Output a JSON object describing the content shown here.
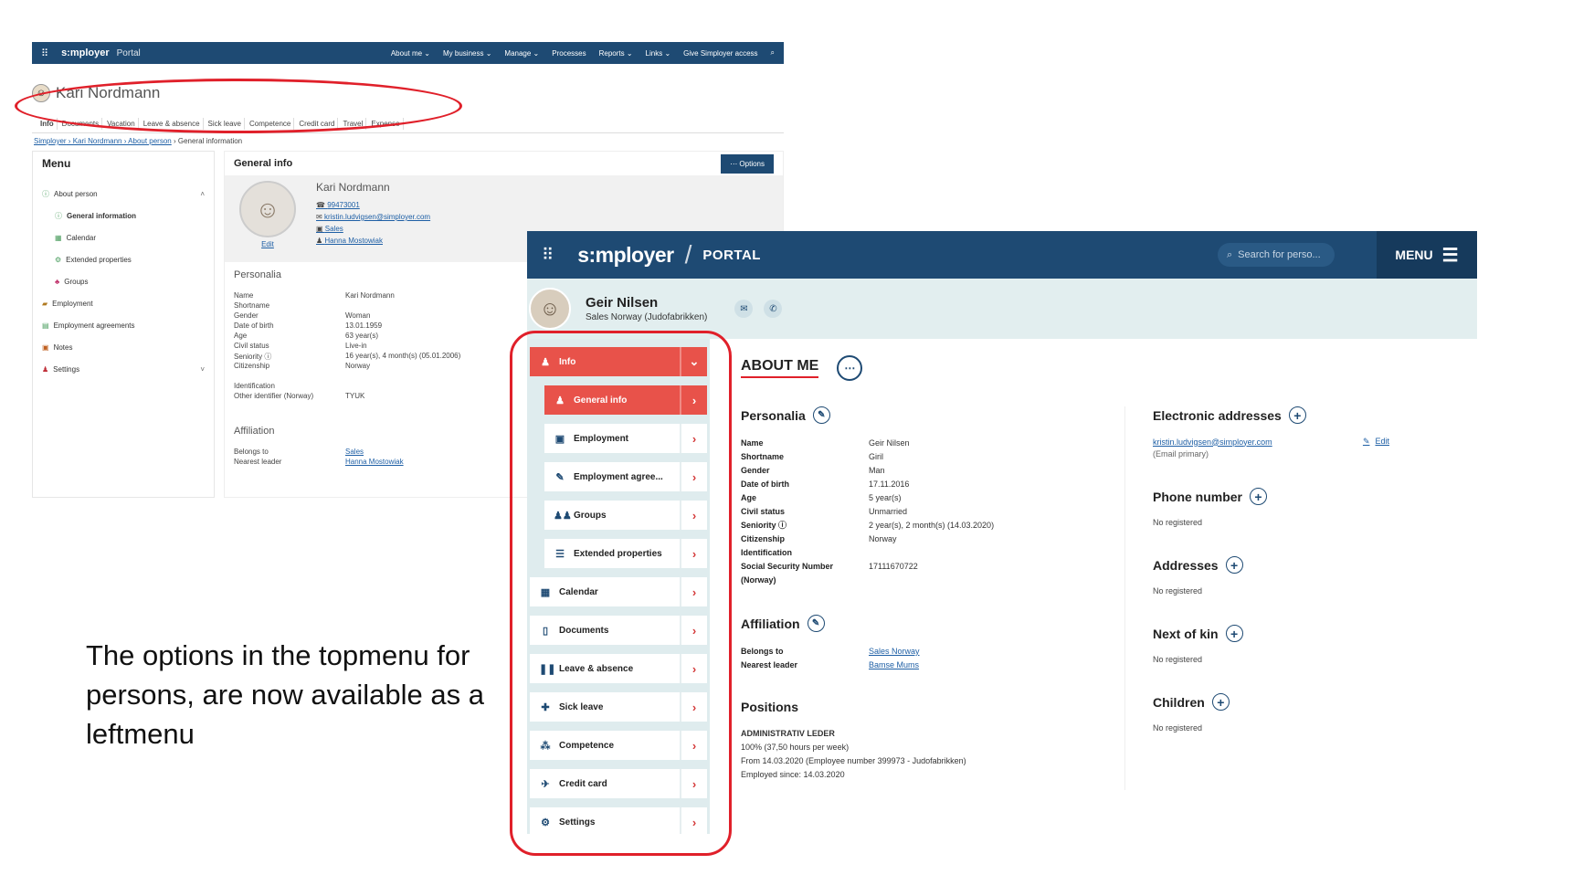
{
  "old_portal": {
    "topbar": {
      "logo": "s:mployer",
      "portal": "Portal",
      "nav": [
        "About me ⌄",
        "My business ⌄",
        "Manage ⌄",
        "Processes",
        "Reports ⌄",
        "Links ⌄",
        "Give Simployer access"
      ]
    },
    "person_name": "Kari Nordmann",
    "tabs": [
      "Info",
      "Documents",
      "Vacation",
      "Leave & absence",
      "Sick leave",
      "Competence",
      "Credit card",
      "Travel",
      "Expense"
    ],
    "breadcrumb": {
      "root": "Simployer",
      "middle": " › Kari Nordmann › About person",
      "current": " › General information"
    },
    "menu": {
      "title": "Menu",
      "items": [
        {
          "label": "About person",
          "sub": false
        },
        {
          "label": "General information",
          "sub": true
        },
        {
          "label": "Calendar",
          "sub": true
        },
        {
          "label": "Extended properties",
          "sub": true
        },
        {
          "label": "Groups",
          "sub": true
        },
        {
          "label": "Employment",
          "sub": false
        },
        {
          "label": "Employment agreements",
          "sub": false
        },
        {
          "label": "Notes",
          "sub": false
        },
        {
          "label": "Settings",
          "sub": false
        }
      ]
    },
    "content": {
      "title": "General info",
      "options_label": "Options",
      "card": {
        "name": "Kari Nordmann",
        "phone": "99473001",
        "email": "kristin.ludvigsen@simployer.com",
        "department": "Sales",
        "leader": "Hanna Mostowiak",
        "edit": "Edit"
      },
      "personalia": {
        "title": "Personalia",
        "rows": [
          {
            "k": "Name",
            "v": "Kari Nordmann"
          },
          {
            "k": "Shortname",
            "v": ""
          },
          {
            "k": "Gender",
            "v": "Woman"
          },
          {
            "k": "Date of birth",
            "v": "13.01.1959"
          },
          {
            "k": "Age",
            "v": "63 year(s)"
          },
          {
            "k": "Civil status",
            "v": "Live-in"
          },
          {
            "k": "Seniority ⓘ",
            "v": "16 year(s), 4 month(s) (05.01.2006)"
          },
          {
            "k": "Citizenship",
            "v": "Norway"
          },
          {
            "k": "",
            "v": ""
          },
          {
            "k": "Identification",
            "v": ""
          },
          {
            "k": "Other identifier (Norway)",
            "v": "TYUK"
          }
        ]
      },
      "affiliation": {
        "title": "Affiliation",
        "rows": [
          {
            "k": "Belongs to",
            "v": "Sales"
          },
          {
            "k": "Nearest leader",
            "v": "Hanna Mostowiak"
          }
        ]
      }
    }
  },
  "new_portal": {
    "topbar": {
      "logo": "s:mployer",
      "slash": "/",
      "portal": "PORTAL",
      "search_placeholder": "Search for perso...",
      "menu_label": "MENU"
    },
    "person": {
      "name": "Geir Nilsen",
      "subtitle": "Sales Norway (Judofabrikken)"
    },
    "side_menu": [
      {
        "label": "Info",
        "icon": "person-icon",
        "style": "red",
        "sub": false,
        "arrow": "⌄"
      },
      {
        "label": "General info",
        "icon": "person-icon",
        "style": "red",
        "sub": true,
        "arrow": "›"
      },
      {
        "label": "Employment",
        "icon": "briefcase-icon",
        "style": "white",
        "sub": true,
        "arrow": "›"
      },
      {
        "label": "Employment agree...",
        "icon": "pen-icon",
        "style": "white",
        "sub": true,
        "arrow": "›"
      },
      {
        "label": "Groups",
        "icon": "group-icon",
        "style": "white",
        "sub": true,
        "arrow": "›"
      },
      {
        "label": "Extended properties",
        "icon": "list-icon",
        "style": "white",
        "sub": true,
        "arrow": "›"
      },
      {
        "label": "Calendar",
        "icon": "calendar-icon",
        "style": "white",
        "sub": false,
        "arrow": "›"
      },
      {
        "label": "Documents",
        "icon": "document-icon",
        "style": "white",
        "sub": false,
        "arrow": "›"
      },
      {
        "label": "Leave & absence",
        "icon": "pause-icon",
        "style": "white",
        "sub": false,
        "arrow": "›"
      },
      {
        "label": "Sick leave",
        "icon": "plus-icon",
        "style": "white",
        "sub": false,
        "arrow": "›"
      },
      {
        "label": "Competence",
        "icon": "competence-icon",
        "style": "white",
        "sub": false,
        "arrow": "›"
      },
      {
        "label": "Credit card",
        "icon": "plane-icon",
        "style": "white",
        "sub": false,
        "arrow": "›"
      },
      {
        "label": "Settings",
        "icon": "gear-icon",
        "style": "white",
        "sub": false,
        "arrow": "›"
      }
    ],
    "about": {
      "title": "ABOUT ME",
      "personalia": {
        "title": "Personalia",
        "rows": [
          {
            "k": "Name",
            "v": "Geir Nilsen"
          },
          {
            "k": "Shortname",
            "v": "Giril"
          },
          {
            "k": "Gender",
            "v": "Man"
          },
          {
            "k": "Date of birth",
            "v": "17.11.2016"
          },
          {
            "k": "Age",
            "v": "5 year(s)"
          },
          {
            "k": "Civil status",
            "v": "Unmarried"
          },
          {
            "k": "Seniority ⓘ",
            "v": "2 year(s), 2 month(s) (14.03.2020)"
          },
          {
            "k": "Citizenship",
            "v": "Norway"
          },
          {
            "k": "Identification",
            "v": ""
          },
          {
            "k": "Social Security Number",
            "v": "17111670722"
          },
          {
            "k": "(Norway)",
            "v": ""
          }
        ]
      },
      "affiliation": {
        "title": "Affiliation",
        "rows": [
          {
            "k": "Belongs to",
            "v": "Sales Norway"
          },
          {
            "k": "Nearest leader",
            "v": "Bamse Mums"
          }
        ]
      },
      "positions": {
        "title": "Positions",
        "role": "ADMINISTRATIV LEDER",
        "lines": [
          "100% (37,50 hours per week)",
          "From 14.03.2020 (Employee number 399973 - Judofabrikken)",
          "Employed since: 14.03.2020"
        ]
      },
      "right": {
        "electronic": {
          "title": "Electronic addresses",
          "email": "kristin.ludvigsen@simployer.com",
          "edit": "Edit",
          "note": "(Email primary)"
        },
        "phone": {
          "title": "Phone number",
          "note": "No registered"
        },
        "addresses": {
          "title": "Addresses",
          "note": "No registered"
        },
        "kin": {
          "title": "Next of kin",
          "note": "No registered"
        },
        "children": {
          "title": "Children",
          "note": "No registered"
        }
      }
    }
  },
  "caption": "The options in the topmenu for persons, are now available as a leftmenu"
}
